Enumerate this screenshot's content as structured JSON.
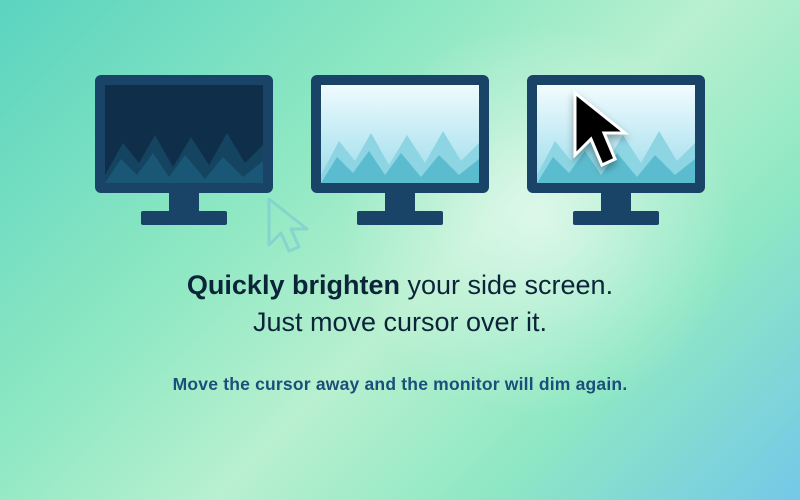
{
  "headline": {
    "bold": "Quickly brighten",
    "line1_rest": " your side screen.",
    "line2": "Just move cursor over it."
  },
  "subline": "Move the cursor away and the monitor will dim again.",
  "colors": {
    "frame": "#1a4368",
    "screen_dark": "#0e2e4a",
    "mountains_mid": "#4aa8b8",
    "mountains_light": "#7cc8d6",
    "sky_light_top": "#e8f7fb",
    "sky_light_bottom": "#a8e0ec"
  }
}
